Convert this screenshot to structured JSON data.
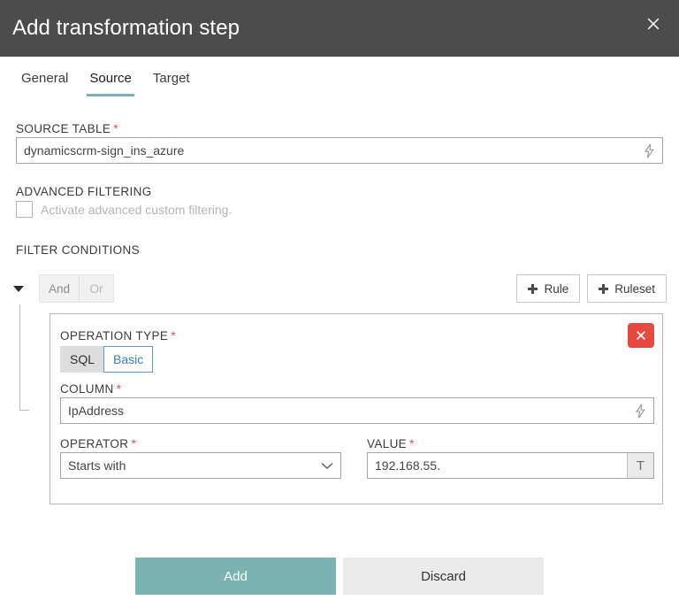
{
  "dialog": {
    "title": "Add transformation step",
    "close_icon": "close-icon"
  },
  "tabs": [
    {
      "label": "General",
      "active": false
    },
    {
      "label": "Source",
      "active": true
    },
    {
      "label": "Target",
      "active": false
    }
  ],
  "source_table": {
    "label": "SOURCE TABLE",
    "required_marker": "*",
    "value": "dynamicscrm-sign_ins_azure",
    "placeholder": "",
    "action_icon": "lightning-bolt-icon"
  },
  "advanced_filtering": {
    "label": "ADVANCED FILTERING",
    "checkbox_label": "Activate advanced custom filtering.",
    "checked": false
  },
  "filter_conditions": {
    "label": "FILTER CONDITIONS",
    "collapse_icon": "caret-down-icon",
    "logic": {
      "and_label": "And",
      "or_label": "Or",
      "selected": "And"
    },
    "add_rule_label": "Rule",
    "add_ruleset_label": "Ruleset",
    "add_icon": "plus-icon"
  },
  "rule": {
    "operation_type": {
      "label": "OPERATION TYPE",
      "required_marker": "*",
      "options": [
        "SQL",
        "Basic"
      ],
      "selected": "SQL"
    },
    "delete_icon": "close-icon",
    "column": {
      "label": "COLUMN",
      "required_marker": "*",
      "value": "IpAddress",
      "placeholder": "",
      "action_icon": "lightning-bolt-icon"
    },
    "operator": {
      "label": "OPERATOR",
      "required_marker": "*",
      "value": "Starts with",
      "options": [
        "Starts with"
      ],
      "dropdown_icon": "chevron-down-icon"
    },
    "value": {
      "label": "VALUE",
      "required_marker": "*",
      "value": "192.168.55.",
      "placeholder": "",
      "type_icon": "text-type-icon",
      "type_glyph": "T"
    }
  },
  "footer": {
    "add_label": "Add",
    "discard_label": "Discard"
  },
  "colors": {
    "header_bg": "#4c4c4c",
    "accent_teal": "#7bb3b3",
    "required_red": "#e8513f",
    "delete_red": "#e8483f",
    "basic_blue": "#3a7cbd"
  }
}
